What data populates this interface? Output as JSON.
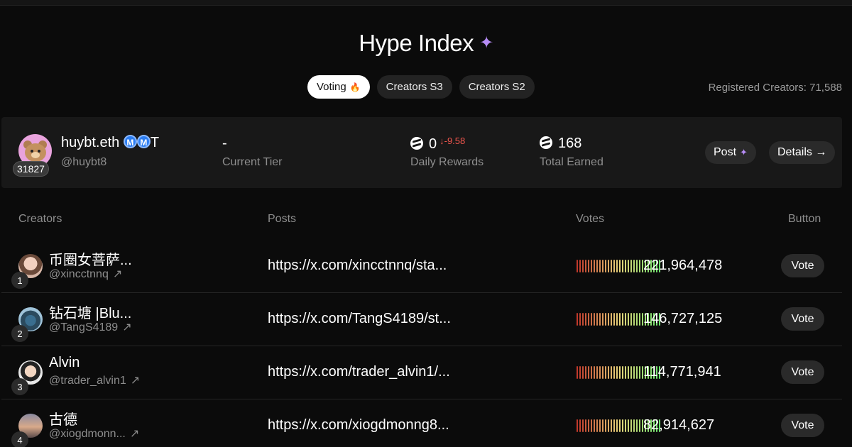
{
  "header": {
    "title": "Hype Index",
    "title_icon": "sparkle-icon"
  },
  "tabs": [
    {
      "label": "Voting",
      "icon": "flame-icon",
      "active": true
    },
    {
      "label": "Creators S3",
      "active": false
    },
    {
      "label": "Creators S2",
      "active": false
    }
  ],
  "registered": "Registered Creators: 71,588",
  "profile": {
    "name": "huybt.eth",
    "badges": [
      "M",
      "M"
    ],
    "name_suffix": "T",
    "handle": "@huybt8",
    "rank": "31827",
    "tier_value": "-",
    "tier_label": "Current Tier",
    "daily_value": "0",
    "daily_delta": "↓-9.58",
    "daily_label": "Daily Rewards",
    "total_value": "168",
    "total_label": "Total Earned",
    "post_label": "Post",
    "details_label": "Details →"
  },
  "table": {
    "headers": {
      "creators": "Creators",
      "posts": "Posts",
      "votes": "Votes",
      "button": "Button"
    },
    "vote_label": "Vote",
    "rows": [
      {
        "rank": "1",
        "name": "币圈女菩萨...",
        "handle": "@xincctnnq",
        "post": "https://x.com/xincctnnq/sta...",
        "votes": "221,964,478"
      },
      {
        "rank": "2",
        "name": "钻石塘 |Blu...",
        "handle": "@TangS4189",
        "post": "https://x.com/TangS4189/st...",
        "votes": "146,727,125"
      },
      {
        "rank": "3",
        "name": "Alvin",
        "handle": "@trader_alvin1",
        "post": "https://x.com/trader_alvin1/...",
        "votes": "114,771,941"
      },
      {
        "rank": "4",
        "name": "古德",
        "handle": "@xiogdmonn...",
        "post": "https://x.com/xiogdmonng8...",
        "votes": "82,914,627"
      }
    ]
  },
  "colors": {
    "accent_purple": "#b68cf5",
    "negative": "#f0564d",
    "bar_low": "#c0392b",
    "bar_mid": "#e8d27a",
    "bar_high": "#6fe36f"
  }
}
